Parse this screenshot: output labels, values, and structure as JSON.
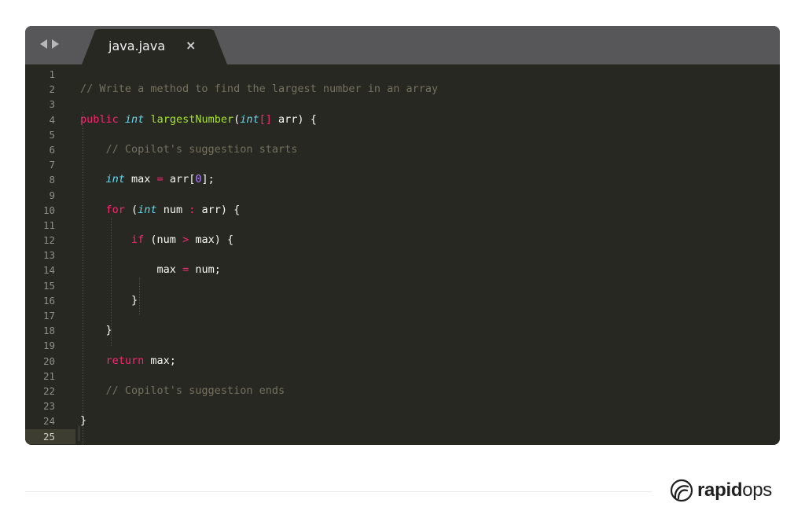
{
  "editor": {
    "tab": {
      "label": "java.java",
      "close_glyph": "×"
    },
    "line_numbers": [
      "1",
      "2",
      "3",
      "4",
      "5",
      "6",
      "7",
      "8",
      "9",
      "10",
      "11",
      "12",
      "13",
      "14",
      "15",
      "16",
      "17",
      "18",
      "19",
      "20",
      "21",
      "22",
      "23",
      "24",
      "25"
    ],
    "active_line": "25",
    "code": {
      "comment_task": "// Write a method to find the largest number in an array",
      "sig_public": "public",
      "sig_int": "int",
      "sig_name": "largestNumber",
      "sig_paren_open": "(",
      "sig_int2": "int",
      "sig_brackets": "[]",
      "sig_rest": " arr) {",
      "comment_start": "// Copilot's suggestion starts",
      "l8_int": "int",
      "l8_a": " max ",
      "l8_eq": "=",
      "l8_b": " arr[",
      "l8_zero": "0",
      "l8_c": "];",
      "l10_for": "for",
      "l10_a": " (",
      "l10_int": "int",
      "l10_b": " num ",
      "l10_colon": ":",
      "l10_c": " arr) {",
      "l12_if": "if",
      "l12_a": " (num ",
      "l12_gt": ">",
      "l12_b": " max) {",
      "l14_a": "max ",
      "l14_eq": "=",
      "l14_b": " num;",
      "close_brace": "}",
      "l20_return": "return",
      "l20_rest": " max;",
      "comment_end": "// Copilot's suggestion ends"
    }
  },
  "brand": {
    "logo_bold": "rapid",
    "logo_light": "ops",
    "logo_icon": "rapidops-swirl-icon"
  },
  "colors": {
    "editor_bg": "#272822",
    "tabbar_bg": "#57575a",
    "keyword": "#f92672",
    "type": "#66d9ef",
    "function": "#a6e22e",
    "number": "#ae81ff",
    "comment": "#75715e"
  }
}
